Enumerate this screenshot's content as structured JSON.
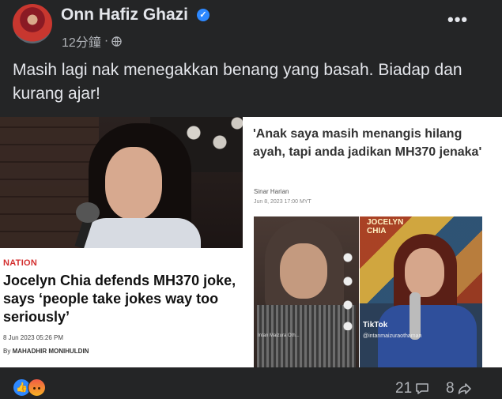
{
  "post": {
    "author": "Onn Hafiz Ghazi",
    "time": "12分鐘",
    "dot": "·",
    "text": "Masih lagi nak menegakkan benang yang basah. Biadap dan kurang ajar!"
  },
  "image": {
    "left_article": {
      "section": "NATION",
      "headline": "Jocelyn Chia defends MH370 joke, says ‘people take jokes way too seriously’",
      "date": "8 Jun 2023 05:26 PM",
      "byline_prefix": "By",
      "byline_author": "MAHADHIR MONIHULDIN"
    },
    "right_article": {
      "title": "'Anak saya masih menangis hilang ayah, tapi anda jadikan MH370 jenaka'",
      "source": "Sinar Harian",
      "date": "Jun 8, 2023 17:00 MYT",
      "mural_label": "JOCELYN CHIA",
      "tiktok_label": "TikTok",
      "tiktok_user": "@intanmaizuraothaman",
      "left_user": "Intan Maizura Oth..."
    }
  },
  "footer": {
    "comments": "21",
    "shares": "8"
  },
  "icons": {
    "verified": "verified-badge-icon",
    "globe": "globe-icon",
    "more": "more-options-icon",
    "like": "like-reaction-icon",
    "angry": "angry-reaction-icon",
    "comment": "comment-icon",
    "share": "share-icon"
  },
  "colors": {
    "background": "#242526",
    "text": "#e4e6eb",
    "muted": "#b0b3b8",
    "accent": "#2d88ff",
    "nation_red": "#d32f2f"
  }
}
